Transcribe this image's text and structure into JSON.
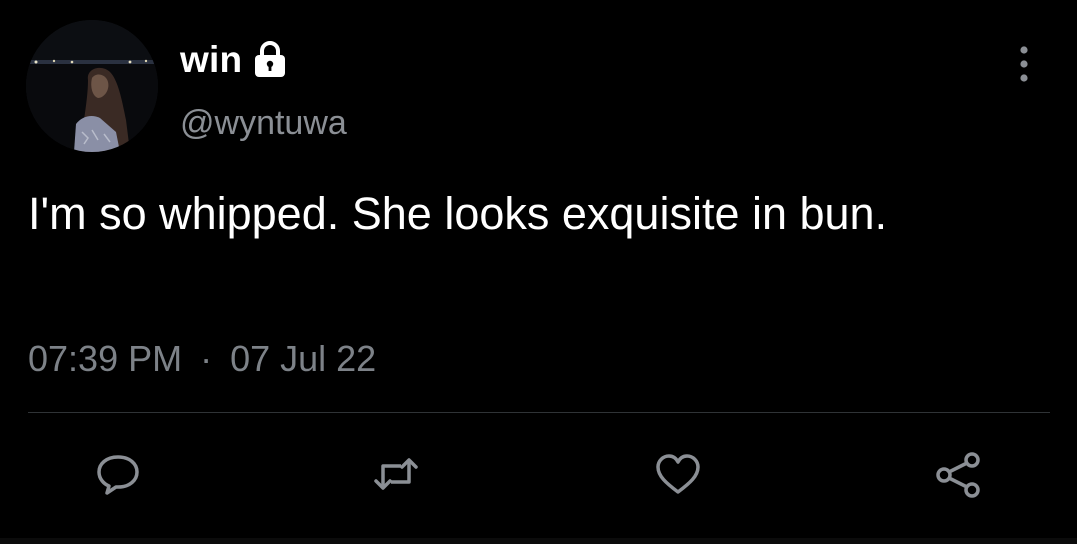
{
  "user": {
    "display_name": "win",
    "handle": "@wyntuwa",
    "protected_icon": "lock-icon"
  },
  "tweet": {
    "text": "I'm so whipped. She looks exquisite in bun.",
    "time": "07:39 PM",
    "separator": "·",
    "date": "07 Jul 22"
  },
  "actions": [
    {
      "name": "reply",
      "icon": "speech-bubble-icon"
    },
    {
      "name": "retweet",
      "icon": "retweet-arrows-icon"
    },
    {
      "name": "like",
      "icon": "heart-outline-icon"
    },
    {
      "name": "share",
      "icon": "share-nodes-icon"
    }
  ],
  "colors": {
    "background": "#000000",
    "text_primary": "#ffffff",
    "text_secondary": "#7d8288",
    "icon": "#8b8f95",
    "divider": "#2f3336"
  }
}
